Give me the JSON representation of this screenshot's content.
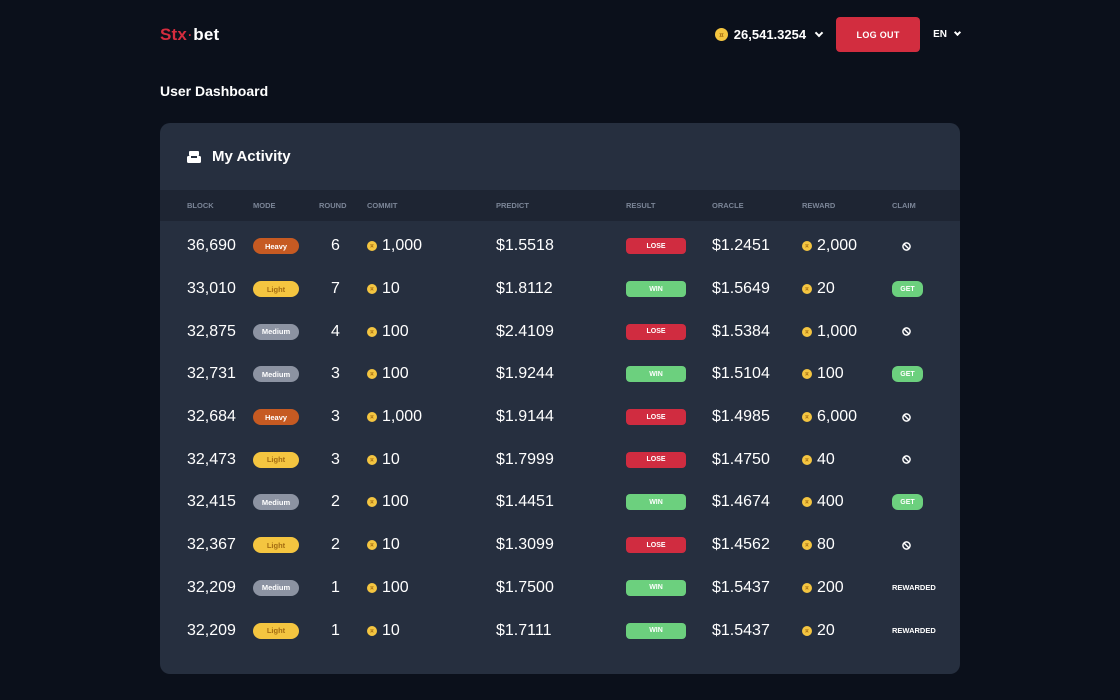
{
  "header": {
    "logo_part1": "Stx",
    "logo_dot": "·",
    "logo_part2": "bet",
    "balance": "26,541.3254",
    "logout_label": "LOG OUT",
    "language": "EN"
  },
  "page_title": "User Dashboard",
  "activity": {
    "title": "My Activity",
    "columns": {
      "block": "BLOCK",
      "mode": "MODE",
      "round": "ROUND",
      "commit": "COMMIT",
      "predict": "PREDICT",
      "result": "RESULT",
      "oracle": "ORACLE",
      "reward": "REWARD",
      "claim": "CLAIM"
    },
    "rows": [
      {
        "block": "36,690",
        "mode": "Heavy",
        "round": "6",
        "commit": "1,000",
        "predict": "$1.5518",
        "result": "LOSE",
        "oracle": "$1.2451",
        "reward": "2,000",
        "claim": "none"
      },
      {
        "block": "33,010",
        "mode": "Light",
        "round": "7",
        "commit": "10",
        "predict": "$1.8112",
        "result": "WIN",
        "oracle": "$1.5649",
        "reward": "20",
        "claim": "GET"
      },
      {
        "block": "32,875",
        "mode": "Medium",
        "round": "4",
        "commit": "100",
        "predict": "$2.4109",
        "result": "LOSE",
        "oracle": "$1.5384",
        "reward": "1,000",
        "claim": "none"
      },
      {
        "block": "32,731",
        "mode": "Medium",
        "round": "3",
        "commit": "100",
        "predict": "$1.9244",
        "result": "WIN",
        "oracle": "$1.5104",
        "reward": "100",
        "claim": "GET"
      },
      {
        "block": "32,684",
        "mode": "Heavy",
        "round": "3",
        "commit": "1,000",
        "predict": "$1.9144",
        "result": "LOSE",
        "oracle": "$1.4985",
        "reward": "6,000",
        "claim": "none"
      },
      {
        "block": "32,473",
        "mode": "Light",
        "round": "3",
        "commit": "10",
        "predict": "$1.7999",
        "result": "LOSE",
        "oracle": "$1.4750",
        "reward": "40",
        "claim": "none"
      },
      {
        "block": "32,415",
        "mode": "Medium",
        "round": "2",
        "commit": "100",
        "predict": "$1.4451",
        "result": "WIN",
        "oracle": "$1.4674",
        "reward": "400",
        "claim": "GET"
      },
      {
        "block": "32,367",
        "mode": "Light",
        "round": "2",
        "commit": "10",
        "predict": "$1.3099",
        "result": "LOSE",
        "oracle": "$1.4562",
        "reward": "80",
        "claim": "none"
      },
      {
        "block": "32,209",
        "mode": "Medium",
        "round": "1",
        "commit": "100",
        "predict": "$1.7500",
        "result": "WIN",
        "oracle": "$1.5437",
        "reward": "200",
        "claim": "REWARDED"
      },
      {
        "block": "32,209",
        "mode": "Light",
        "round": "1",
        "commit": "10",
        "predict": "$1.7111",
        "result": "WIN",
        "oracle": "$1.5437",
        "reward": "20",
        "claim": "REWARDED"
      }
    ]
  },
  "colors": {
    "background": "#0b101b",
    "card": "#262f3f",
    "accent_red": "#d22d3f",
    "win_green": "#6cd07e",
    "coin_gold": "#f4c540"
  },
  "icons": {
    "coin": "coin-icon",
    "activity": "inbox-icon",
    "no_claim": "ban-icon",
    "dropdown": "chevron-down-icon"
  }
}
